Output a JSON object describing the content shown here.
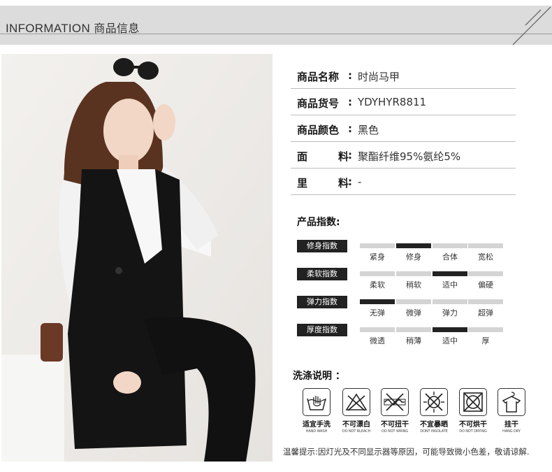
{
  "header": {
    "title_en": "INFORMATION",
    "title_cn": "商品信息"
  },
  "photo": {
    "icon": "model-in-black-vest-photo"
  },
  "info": [
    {
      "label": "商品名称",
      "value": "时尚马甲",
      "spread": false
    },
    {
      "label": "商品货号",
      "value": "YDYHYR8811",
      "spread": false
    },
    {
      "label": "商品颜色",
      "value": "黑色",
      "spread": false
    },
    {
      "label": "面料",
      "value": "聚酯纤维95%氨纶5%",
      "spread": true
    },
    {
      "label": "里料",
      "value": "-",
      "spread": true
    }
  ],
  "indices_title": "产品指数:",
  "indices": [
    {
      "label": "修身指数",
      "options": [
        "紧身",
        "修身",
        "合体",
        "宽松"
      ],
      "selected": 1
    },
    {
      "label": "柔软指数",
      "options": [
        "柔软",
        "稍软",
        "适中",
        "偏硬"
      ],
      "selected": 2
    },
    {
      "label": "弹力指数",
      "options": [
        "无弹",
        "微弹",
        "弹力",
        "超弹"
      ],
      "selected": 0
    },
    {
      "label": "厚度指数",
      "options": [
        "微透",
        "稍薄",
        "适中",
        "厚"
      ],
      "selected": 2
    }
  ],
  "wash_title": "洗涤说明 ：",
  "care": [
    {
      "icon": "hand-wash-icon",
      "cn": "适宜手洗",
      "en": "HAND WASH"
    },
    {
      "icon": "no-bleach-icon",
      "cn": "不可漂白",
      "en": "DO NOT BLEACH"
    },
    {
      "icon": "no-wring-icon",
      "cn": "不可扭干",
      "en": "DO NOT WRING"
    },
    {
      "icon": "no-sunlight-icon",
      "cn": "不宜暴晒",
      "en": "DONT INSOLATE"
    },
    {
      "icon": "no-tumble-dry-icon",
      "cn": "不可烘干",
      "en": "DO NOT DRYING"
    },
    {
      "icon": "hang-dry-icon",
      "cn": "挂干",
      "en": "HANG DRY"
    }
  ],
  "notice": "温馨提示:因灯光及不同显示器等原因，可能导致微小色差，敬请谅解."
}
